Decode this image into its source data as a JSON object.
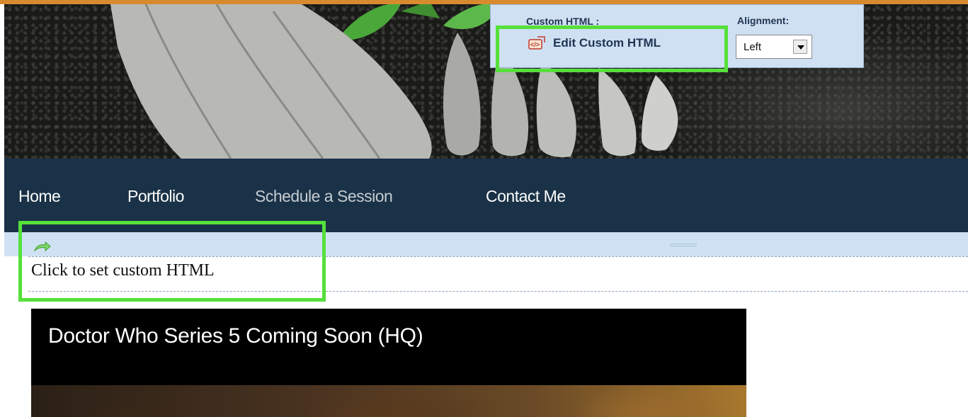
{
  "editor_popup": {
    "custom_html_label": "Custom HTML :",
    "edit_button_label": "Edit Custom HTML",
    "alignment_label": "Alignment:",
    "alignment_value": "Left"
  },
  "nav": {
    "items": [
      {
        "label": "Home"
      },
      {
        "label": "Portfolio"
      },
      {
        "label": "Schedule a Session"
      },
      {
        "label": "Contact Me"
      }
    ]
  },
  "custom_html_block": {
    "placeholder": "Click to set custom HTML"
  },
  "video": {
    "title": "Doctor Who Series 5 Coming Soon (HQ)"
  },
  "colors": {
    "highlight": "#55e03a",
    "navbar": "#1a3247",
    "popup_bg": "#cfe0f2",
    "top_strip": "#d88a2e"
  },
  "icons": [
    "edit-html-icon",
    "move-arrow-icon",
    "select-arrow-icon"
  ]
}
